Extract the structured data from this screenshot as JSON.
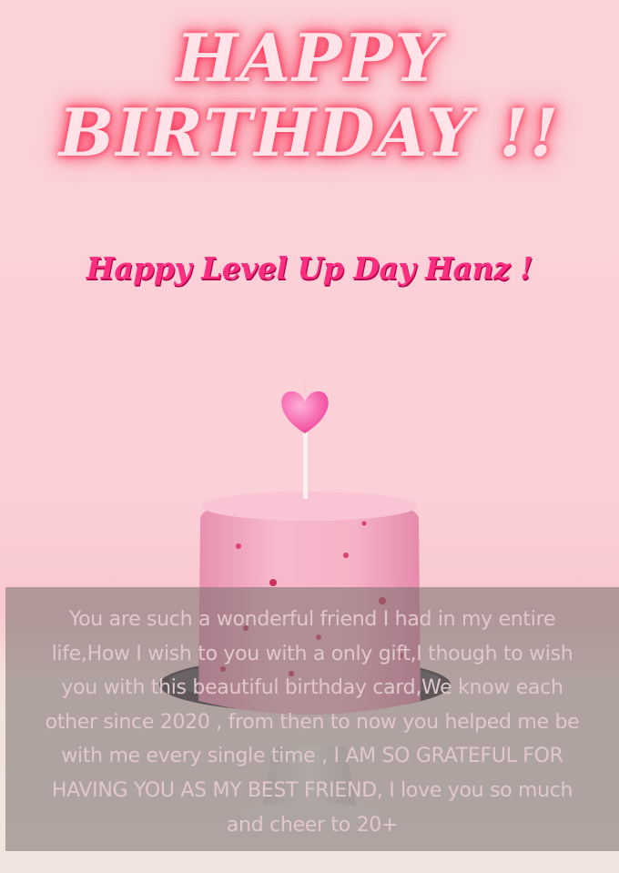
{
  "card": {
    "title_line_1": "HAPPY",
    "title_line_2": "BIRTHDAY !!",
    "subtitle": "Happy Level Up Day Hanz !",
    "message_lines": [
      "You are such a wonderful friend I had in my entire",
      "life,How I wish to you with a only gift,I though to wish",
      "you with this beautiful birthday card,We know each",
      "other since 2020 , from then to now you helped me be",
      "with me every single time , I AM SO GRATEFUL FOR",
      "HAVING YOU AS MY BEST FRIEND, I love you so much",
      "and cheer to 20+"
    ]
  },
  "colors": {
    "background": "#fbd3d8",
    "title_glow": "#ff2d55",
    "subtitle": "#ff2d80",
    "cake_frosting": "#f5a9bf",
    "candle_heart": "#ff5fa8"
  },
  "icons": {
    "cake": "birthday-cake-illustration",
    "candle": "heart-candle-icon"
  }
}
